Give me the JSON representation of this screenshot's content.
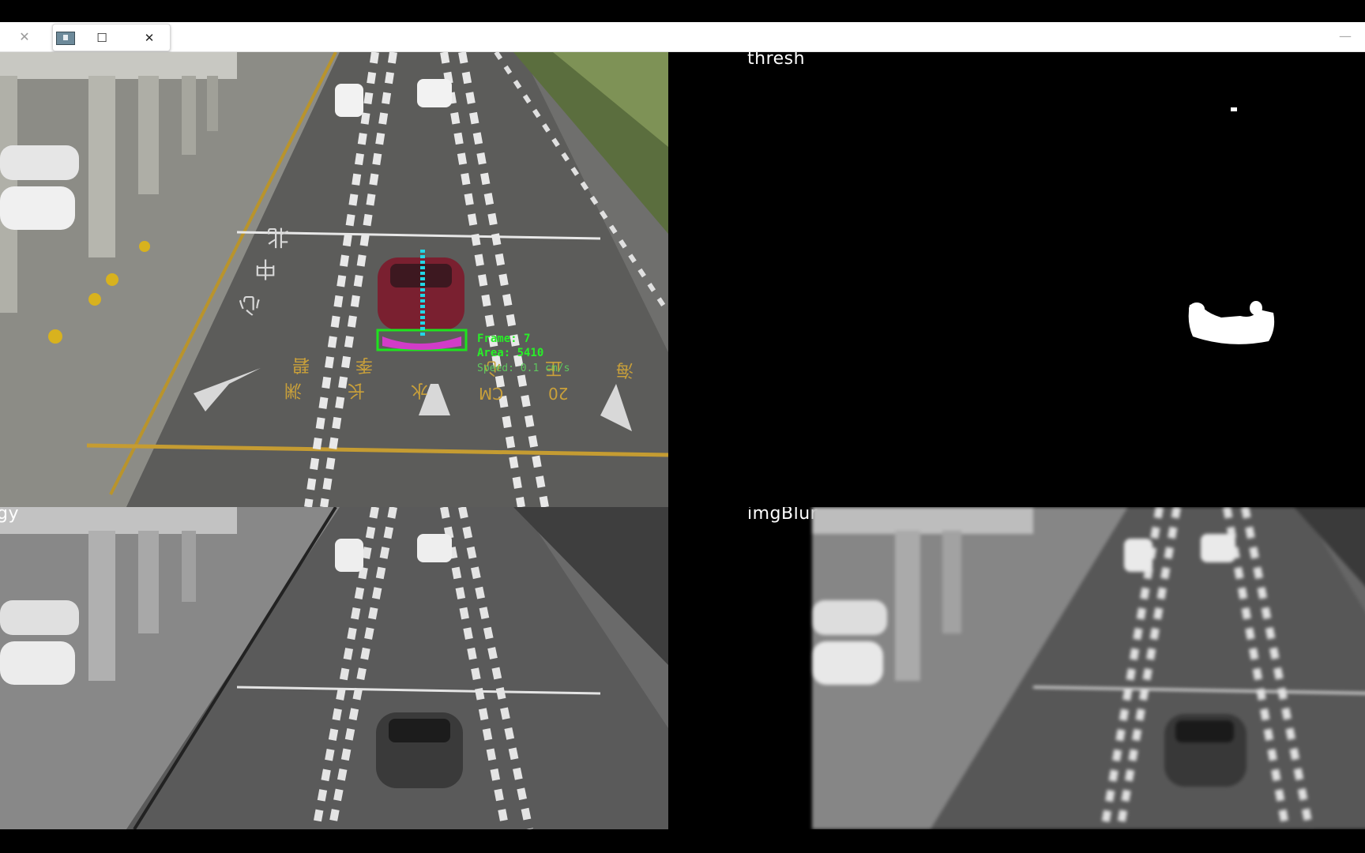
{
  "window": {
    "close_glyph": "✕",
    "maximize_glyph": "☐",
    "minimize_glyph": "—"
  },
  "panels": {
    "original": {},
    "thresh": {
      "title": "thresh"
    },
    "gray": {
      "title": "gy"
    },
    "blur": {
      "title": "imgBlur"
    }
  },
  "road_markings": {
    "chars_row1": [
      "北",
      "中",
      "心"
    ],
    "chars_bottom": [
      "碧",
      "季",
      "渊",
      "心",
      "正",
      "长",
      "水",
      "海",
      "CM",
      "20"
    ]
  },
  "detection": {
    "label_line1": "Frame: 7",
    "label_line2": "Area: 5410",
    "label_line3": "Speed: 0.1 cm/s"
  },
  "colors": {
    "box": "#1ee31e",
    "tracker": "#22d6e6",
    "mask": "#d23cc8",
    "car": "#7a2030"
  }
}
